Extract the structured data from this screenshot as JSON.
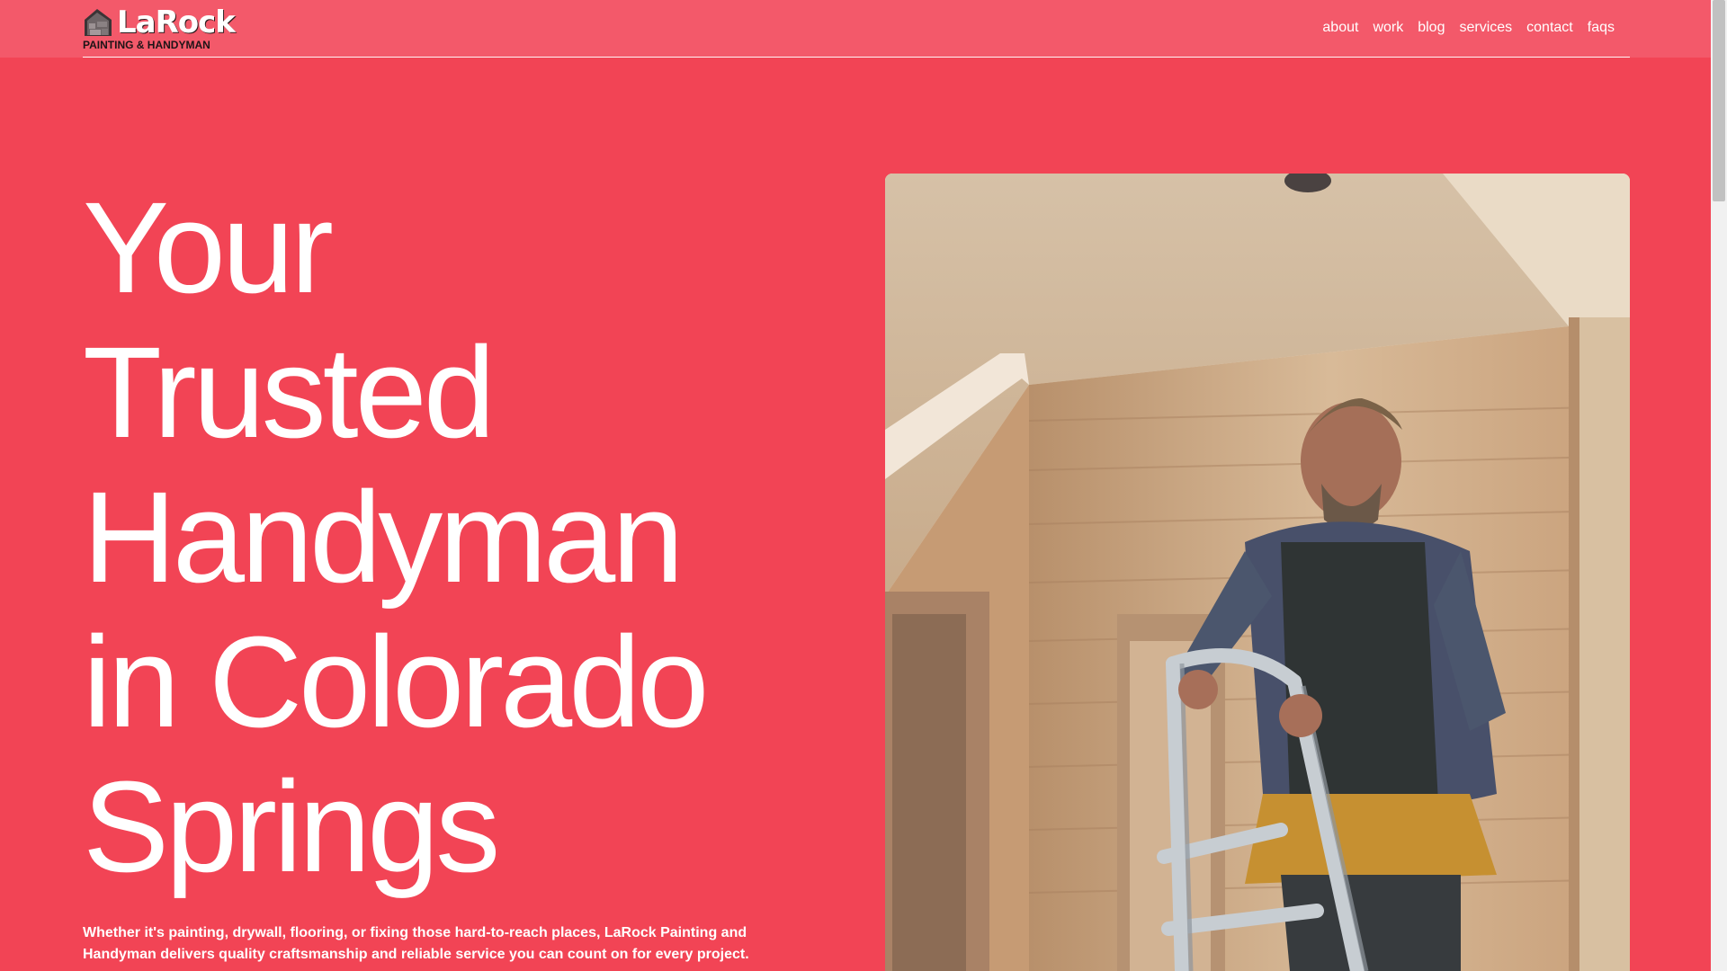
{
  "brand": {
    "name": "LaRock",
    "tagline": "PAINTING & HANDYMAN",
    "logo_icon": "stone-house-icon",
    "logo_color": "#2b2426"
  },
  "nav": {
    "items": [
      {
        "label": "about"
      },
      {
        "label": "work"
      },
      {
        "label": "blog"
      },
      {
        "label": "services"
      },
      {
        "label": "contact"
      },
      {
        "label": "faqs"
      }
    ]
  },
  "hero": {
    "title_lines": [
      "Your",
      "Trusted",
      "Handyman",
      "in Colorado",
      "Springs"
    ],
    "description": "Whether it's painting, drywall, flooring, or fixing those hard-to-reach places, LaRock Painting and Handyman delivers quality craftsmanship and reliable service you can count on for every project.",
    "image_subject": "handyman-on-ladder-photo"
  },
  "colors": {
    "background": "#f24455",
    "header_background": "#f3596a",
    "text": "#ffffff"
  }
}
